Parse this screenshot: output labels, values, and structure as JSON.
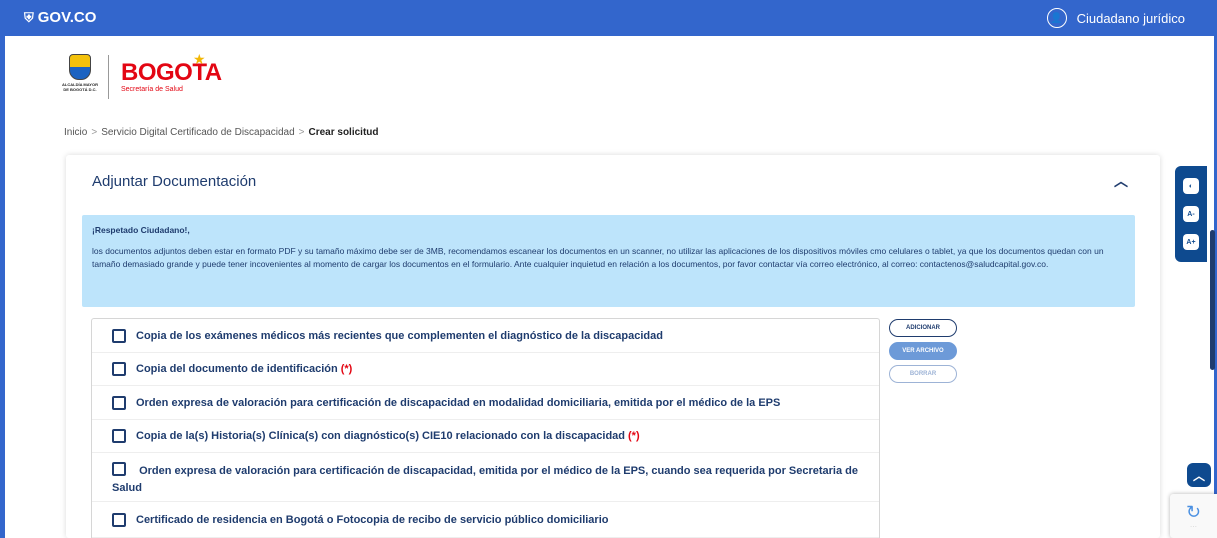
{
  "topbar": {
    "brand": "GOV.CO",
    "brand_icon": "shield-icon",
    "user_label": "Ciudadano jurídico",
    "user_icon": "user-circle-icon"
  },
  "logos": {
    "seal_text": "ALCALDÍA MAYOR DE BOGOTÁ D.C.",
    "brand_word": "BOGOTA",
    "brand_sub": "Secretaría de Salud"
  },
  "breadcrumb": {
    "items": [
      "Inicio",
      "Servicio Digital Certificado de Discapacidad",
      "Crear solicitud"
    ],
    "separator": ">"
  },
  "panel": {
    "title": "Adjuntar Documentación",
    "collapse_icon": "chevron-up-icon"
  },
  "notice": {
    "heading": "¡Respetado Ciudadano!,",
    "text": "los documentos adjuntos deben estar en formato PDF y su tamaño máximo debe ser de 3MB, recomendamos escanear los documentos en un scanner, no utilizar las aplicaciones de los dispositivos móviles cmo celulares o tablet, ya que los documentos quedan con un tamaño demasiado grande y puede tener incovenientes al momento de cargar los documentos en el formulario. Ante cualquier inquietud en relación a los documentos, por favor contactar vía correo electrónico, al correo: contactenos@saludcapital.gov.co."
  },
  "documents": [
    {
      "label": "Copia de los exámenes médicos más recientes que complementen el diagnóstico de la discapacidad",
      "required": ""
    },
    {
      "label": "Copia del documento de identificación",
      "required": "(*)"
    },
    {
      "label": "Orden expresa de valoración para certificación de discapacidad en modalidad domiciliaria, emitida por el médico de la EPS",
      "required": ""
    },
    {
      "label": "Copia de la(s) Historia(s) Clínica(s) con diagnóstico(s) CIE10 relacionado con la discapacidad",
      "required": "(*)"
    },
    {
      "label": "Orden expresa de valoración para certificación de discapacidad, emitida por el médico de la EPS, cuando sea requerida por Secretaria de Salud",
      "required": ""
    },
    {
      "label": "Certificado de residencia en Bogotá o Fotocopia de recibo de servicio público domiciliario",
      "required": ""
    }
  ],
  "actions": {
    "add": "ADICIONAR",
    "view": "VER ARCHIVO",
    "delete": "BORRAR"
  },
  "accessibility": {
    "contrast": "◐",
    "font_smaller": "A-",
    "font_larger": "A+"
  },
  "colors": {
    "primary": "#3366cc",
    "navy": "#1f3c6e",
    "notice_bg": "#bde4fb",
    "required": "#e30613"
  }
}
